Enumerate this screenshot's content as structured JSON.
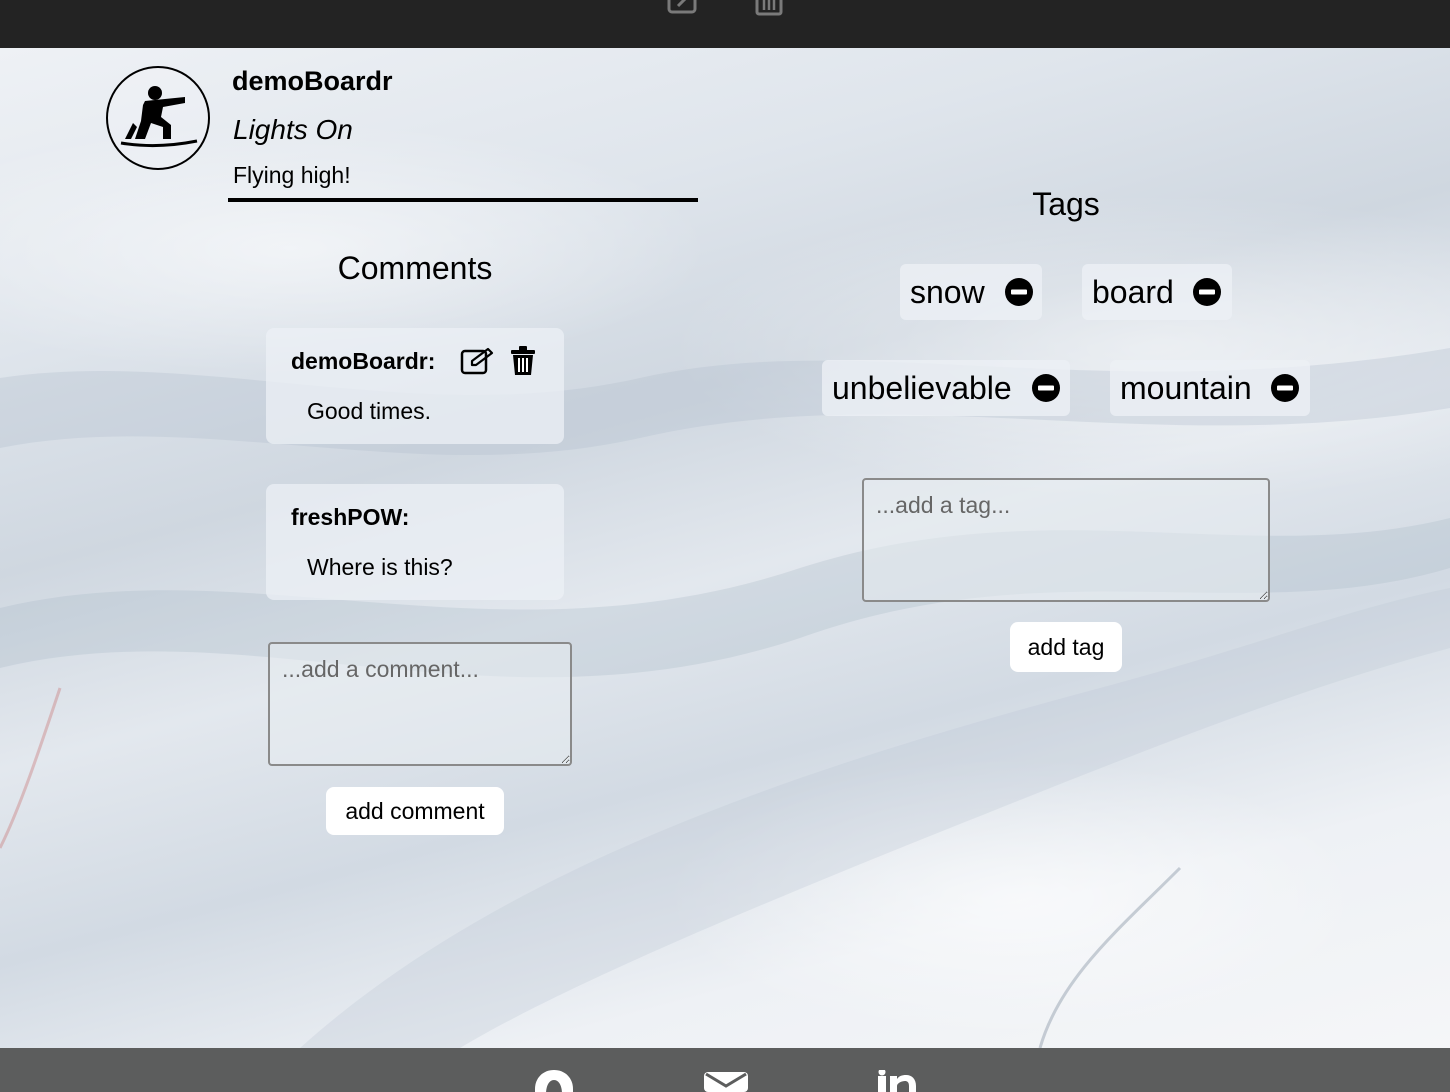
{
  "post": {
    "username": "demoBoardr",
    "title": "Lights On",
    "caption": "Flying high!"
  },
  "comments": {
    "heading": "Comments",
    "items": [
      {
        "author": "demoBoardr:",
        "body": "Good times.",
        "editable": true
      },
      {
        "author": "freshPOW:",
        "body": "Where is this?",
        "editable": false
      }
    ],
    "input_placeholder": "...add a comment...",
    "submit_label": "add comment"
  },
  "tags": {
    "heading": "Tags",
    "items": [
      {
        "label": "snow"
      },
      {
        "label": "board"
      },
      {
        "label": "unbelievable"
      },
      {
        "label": "mountain"
      }
    ],
    "input_placeholder": "...add a tag...",
    "submit_label": "add tag"
  },
  "icons": {
    "topbar": [
      "edit-icon",
      "trash-icon"
    ],
    "comment_tools": [
      "edit-icon",
      "trash-icon"
    ],
    "tag_remove": "minus-circle-icon",
    "footer": [
      "github-icon",
      "envelope-icon",
      "linkedin-icon"
    ]
  },
  "colors": {
    "topbar_bg": "#232323",
    "footer_bg": "#5c5d5d",
    "button_bg": "#ffffff"
  }
}
